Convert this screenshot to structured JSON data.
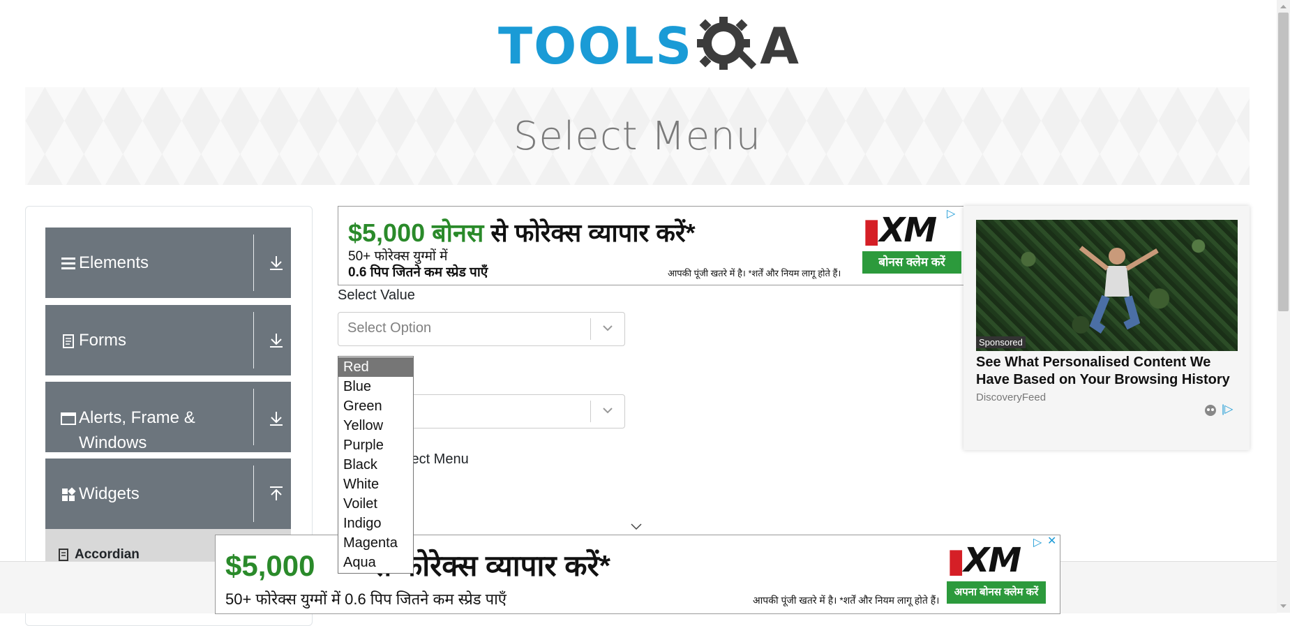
{
  "header": {
    "logo_text_blue": "TOOLS",
    "logo_text_dark": "A"
  },
  "banner": {
    "title": "Select Menu"
  },
  "sidebar": {
    "groups": [
      {
        "label": "Elements",
        "icon": "hamburger-icon",
        "arrow": "download-icon"
      },
      {
        "label": "Forms",
        "icon": "document-icon",
        "arrow": "download-icon"
      },
      {
        "label": "Alerts, Frame &",
        "label2": "Windows",
        "icon": "window-icon",
        "arrow": "download-icon"
      },
      {
        "label": "Widgets",
        "icon": "widgets-icon",
        "arrow": "upload-icon"
      }
    ],
    "sub_items": [
      {
        "label": "Accordian",
        "icon": "document-icon"
      }
    ]
  },
  "ad_top": {
    "headline_amount": "$5,000",
    "headline_bonus": "बोनस",
    "headline_rest": "से फोरेक्स व्यापार करें*",
    "line2": "50+ फोरेक्स युग्मों में",
    "line3": "0.6 पिप जितने कम स्प्रेड पाएँ",
    "disclaimer": "आपकी पूंजी खतरे में है। *शर्तें और नियम लागू होते हैं।",
    "brand": "XM",
    "cta": "बोनस क्लेम करें"
  },
  "ad_bottom": {
    "headline_amount": "$5,000",
    "headline_rest": "से फोरेक्स व्यापार करें*",
    "line2": "50+ फोरेक्स युग्मों में 0.6 पिप जितने कम स्प्रेड पाएँ",
    "disclaimer": "आपकी पूंजी खतरे में है। *शर्तें और नियम लागू होते हैं।",
    "brand": "XM",
    "cta": "अपना बोनस क्लेम करें"
  },
  "form": {
    "select_value_label": "Select Value",
    "select_value_placeholder": "Select Option",
    "old_select_label_partial": "lect Menu"
  },
  "listbox": {
    "selected": "Red",
    "options": [
      "Red",
      "Blue",
      "Green",
      "Yellow",
      "Purple",
      "Black",
      "White",
      "Voilet",
      "Indigo",
      "Magenta",
      "Aqua"
    ]
  },
  "right_ad": {
    "sponsored": "Sponsored",
    "headline": "See What Personalised Content We Have Based on Your Browsing History",
    "source": "DiscoveryFeed"
  },
  "colors": {
    "sidebar_group_bg": "#6c757d",
    "accent_blue": "#1a9bd6",
    "ad_green": "#2c9a3c",
    "ad_red": "#d51f26"
  }
}
